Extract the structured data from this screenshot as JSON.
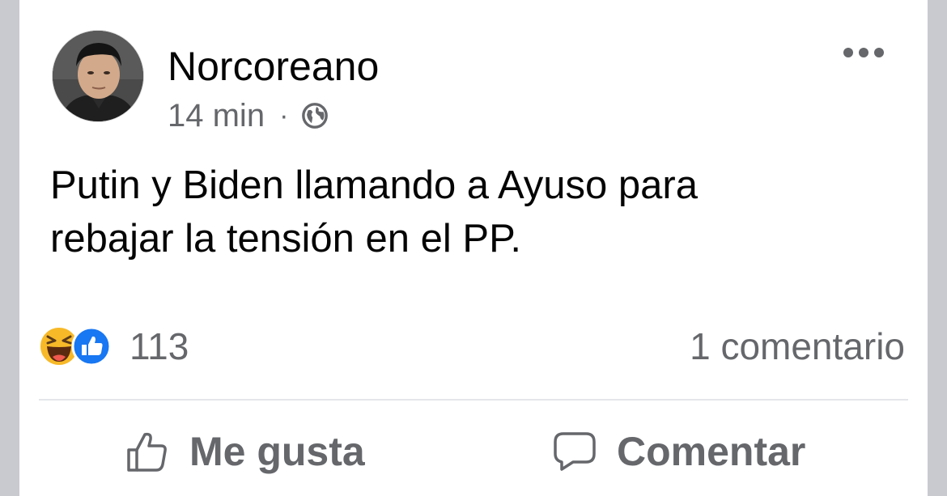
{
  "post": {
    "author": "Norcoreano",
    "time": "14 min",
    "separator": "·",
    "audience_icon": "globe-icon",
    "text_lines": [
      "Putin y Biden llamando a Ayuso para",
      "rebajar la tensión en el PP."
    ],
    "reactions": {
      "icons": [
        "haha-icon",
        "like-icon"
      ],
      "count": "113"
    },
    "comments": "1 comentario",
    "actions": {
      "like_label": "Me gusta",
      "comment_label": "Comentar"
    }
  },
  "colors": {
    "text": "#050505",
    "secondary": "#65676b",
    "like_blue": "#1877f2",
    "haha_yellow": "#f7b928",
    "divider": "#e4e6eb",
    "background": "#c9cacf"
  }
}
